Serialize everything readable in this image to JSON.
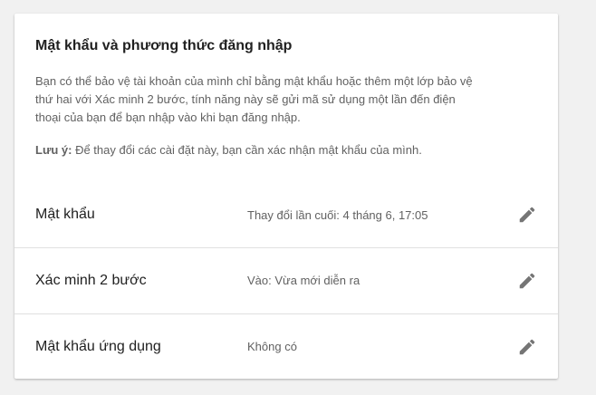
{
  "card": {
    "title": "Mật khẩu và phương thức đăng nhập",
    "description": "Bạn có thể bảo vệ tài khoản của mình chỉ bằng mật khẩu hoặc thêm một lớp bảo vệ thứ hai với Xác minh 2 bước, tính năng này sẽ gửi mã sử dụng một lần đến điện thoại của bạn để bạn nhập vào khi bạn đăng nhập.",
    "note_label": "Lưu ý:",
    "note_text": " Để thay đổi các cài đặt này, bạn cần xác nhận mật khẩu của mình."
  },
  "rows": [
    {
      "label": "Mật khẩu",
      "value": "Thay đổi lần cuối: 4 tháng 6, 17:05",
      "icon": "edit-pencil-icon"
    },
    {
      "label": "Xác minh 2 bước",
      "value": "Vào: Vừa mới diễn ra",
      "icon": "edit-pencil-icon"
    },
    {
      "label": "Mật khẩu ứng dụng",
      "value": "Không có",
      "icon": "edit-pencil-icon"
    }
  ],
  "colors": {
    "page_background": "#f1f1f1",
    "card_background": "#ffffff",
    "primary_text": "#212121",
    "secondary_text": "#616161",
    "icon": "#757575",
    "divider": "#e0e0e0"
  }
}
